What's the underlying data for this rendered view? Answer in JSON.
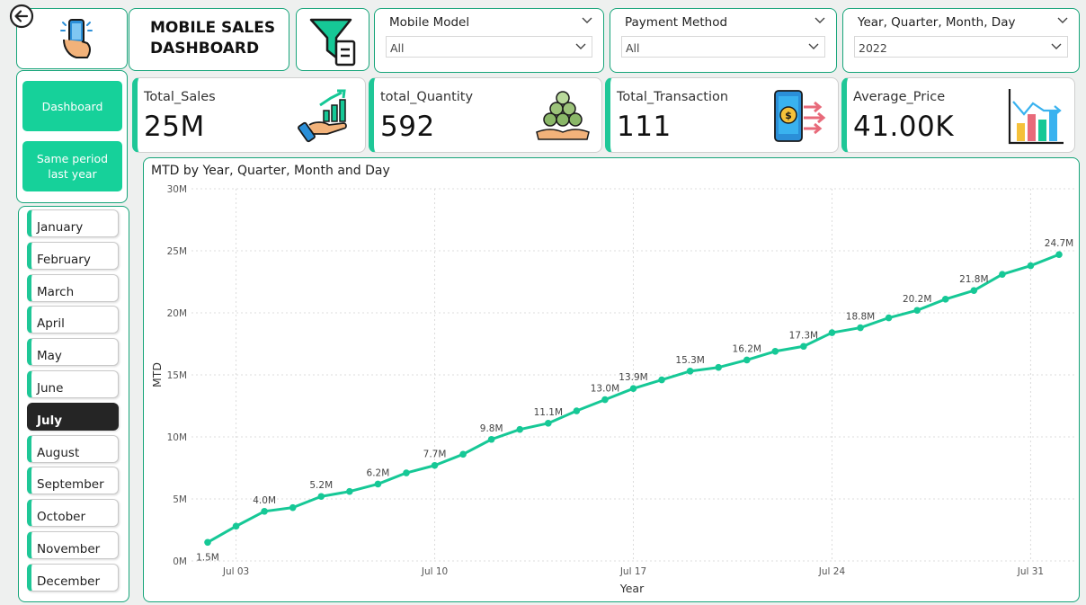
{
  "header": {
    "title_line1": "MOBILE SALES",
    "title_line2": "DASHBOARD"
  },
  "icons": {
    "back": "back-arrow-icon",
    "logo": "phone-in-hand-icon",
    "filter": "filter-icon"
  },
  "slicers": [
    {
      "label": "Mobile Model",
      "value": "All"
    },
    {
      "label": "Payment Method",
      "value": "All"
    },
    {
      "label": "Year, Quarter, Month, Day",
      "value": "2022"
    }
  ],
  "kpis": [
    {
      "label": "Total_Sales",
      "value": "25M",
      "icon": "sales-growth-icon"
    },
    {
      "label": "total_Quantity",
      "value": "592",
      "icon": "coins-stack-icon"
    },
    {
      "label": "Total_Transaction",
      "value": "111",
      "icon": "mobile-payment-icon"
    },
    {
      "label": "Average_Price",
      "value": "41.00K",
      "icon": "bar-chart-icon"
    }
  ],
  "nav": {
    "dashboard": "Dashboard",
    "same_period": "Same period last year"
  },
  "months": [
    "January",
    "February",
    "March",
    "April",
    "May",
    "June",
    "July",
    "August",
    "September",
    "October",
    "November",
    "December"
  ],
  "selected_month": "July",
  "colors": {
    "accent": "#1fc797",
    "line": "#16c896",
    "border": "#17a57a",
    "selected": "#252525"
  },
  "chart_data": {
    "type": "line",
    "title": "MTD by Year, Quarter, Month and Day",
    "xlabel": "Year",
    "ylabel": "MTD",
    "x": [
      "2022-07-02",
      "2022-07-03",
      "2022-07-04",
      "2022-07-05",
      "2022-07-06",
      "2022-07-07",
      "2022-07-08",
      "2022-07-09",
      "2022-07-10",
      "2022-07-11",
      "2022-07-12",
      "2022-07-13",
      "2022-07-14",
      "2022-07-15",
      "2022-07-16",
      "2022-07-17",
      "2022-07-18",
      "2022-07-19",
      "2022-07-20",
      "2022-07-21",
      "2022-07-22",
      "2022-07-23",
      "2022-07-24",
      "2022-07-25",
      "2022-07-26",
      "2022-07-27",
      "2022-07-28",
      "2022-07-29",
      "2022-07-30",
      "2022-07-31"
    ],
    "series": [
      {
        "name": "MTD",
        "values": [
          1.5,
          2.8,
          4.0,
          4.3,
          5.2,
          5.6,
          6.2,
          7.1,
          7.7,
          8.6,
          9.8,
          10.6,
          11.1,
          12.1,
          13.0,
          13.9,
          14.6,
          15.3,
          15.6,
          16.2,
          16.9,
          17.3,
          18.4,
          18.8,
          19.6,
          20.2,
          21.1,
          21.8,
          23.1,
          23.8,
          24.7
        ]
      }
    ],
    "data_labels": [
      {
        "x": "2022-07-02",
        "label": "1.5M"
      },
      {
        "x": "2022-07-03",
        "label": "4.0M"
      },
      {
        "x": "2022-07-05",
        "label": "5.2M"
      },
      {
        "x": "2022-07-07",
        "label": "6.2M"
      },
      {
        "x": "2022-07-09",
        "label": "7.7M"
      },
      {
        "x": "2022-07-11",
        "label": "9.8M"
      },
      {
        "x": "2022-07-13",
        "label": "11.1M"
      },
      {
        "x": "2022-07-15",
        "label": "13.0M"
      },
      {
        "x": "2022-07-16",
        "label": "13.9M"
      },
      {
        "x": "2022-07-18",
        "label": "15.3M"
      },
      {
        "x": "2022-07-20",
        "label": "16.2M"
      },
      {
        "x": "2022-07-22",
        "label": "17.3M"
      },
      {
        "x": "2022-07-24",
        "label": "18.8M"
      },
      {
        "x": "2022-07-26",
        "label": "20.2M"
      },
      {
        "x": "2022-07-28",
        "label": "21.8M"
      },
      {
        "x": "2022-07-31",
        "label": "24.7M"
      }
    ],
    "x_ticks": [
      "Jul 03",
      "Jul 10",
      "Jul 17",
      "Jul 24",
      "Jul 31"
    ],
    "y_ticks": [
      "0M",
      "5M",
      "10M",
      "15M",
      "20M",
      "25M",
      "30M"
    ],
    "ylim": [
      0,
      30
    ],
    "grid": true
  }
}
